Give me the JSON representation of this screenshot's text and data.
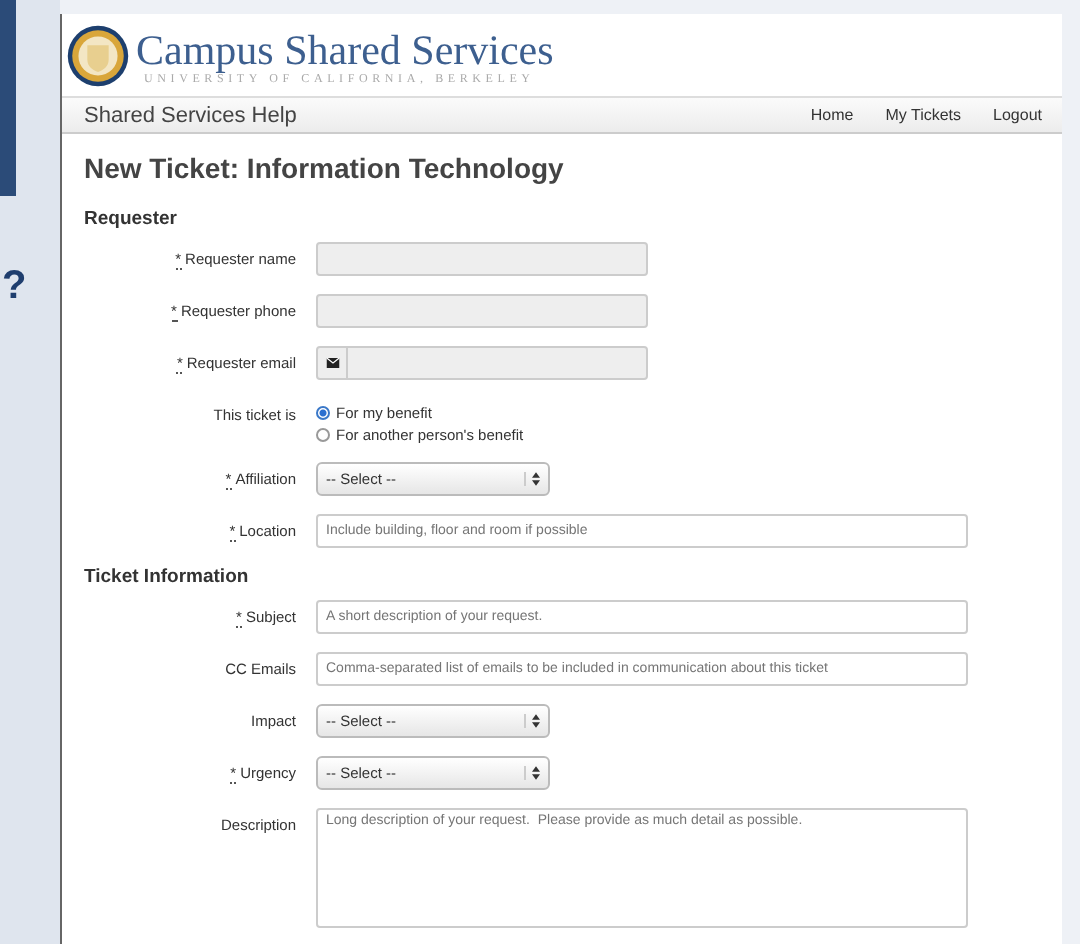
{
  "background_page": {
    "glyph": "?"
  },
  "header": {
    "title": "Campus Shared Services",
    "subtitle": "UNIVERSITY OF CALIFORNIA, BERKELEY"
  },
  "navbar": {
    "brand": "Shared Services Help",
    "links": [
      "Home",
      "My Tickets",
      "Logout"
    ]
  },
  "page_title": "New Ticket: Information Technology",
  "sections": [
    {
      "title": "Requester",
      "fields": [
        {
          "kind": "text",
          "mark": "*",
          "label": "Requester name",
          "disabled": true
        },
        {
          "kind": "text",
          "mark": "*",
          "label": "Requester phone",
          "disabled": true
        },
        {
          "kind": "email",
          "mark": "*",
          "label": "Requester email",
          "disabled": true
        },
        {
          "kind": "radio",
          "label": "This ticket is",
          "options": [
            {
              "label": "For my benefit",
              "selected": true
            },
            {
              "label": "For another person's benefit",
              "selected": false
            }
          ]
        },
        {
          "kind": "select",
          "mark": "*",
          "label": "Affiliation",
          "value": "-- Select --"
        },
        {
          "kind": "text",
          "mark": "*",
          "label": "Location",
          "placeholder": "Include building, floor and room if possible",
          "disabled": false
        }
      ]
    },
    {
      "title": "Ticket Information",
      "fields": [
        {
          "kind": "text",
          "mark": "*",
          "label": "Subject",
          "placeholder": "A short description of your request.",
          "disabled": false
        },
        {
          "kind": "text",
          "label": "CC Emails",
          "placeholder": "Comma-separated list of emails to be included in communication about this ticket",
          "disabled": false
        },
        {
          "kind": "select",
          "label": "Impact",
          "value": "-- Select --"
        },
        {
          "kind": "select",
          "mark": "*",
          "label": "Urgency",
          "value": "-- Select --"
        },
        {
          "kind": "textarea",
          "label": "Description",
          "placeholder": "Long description of your request.  Please provide as much detail as possible."
        }
      ]
    }
  ]
}
